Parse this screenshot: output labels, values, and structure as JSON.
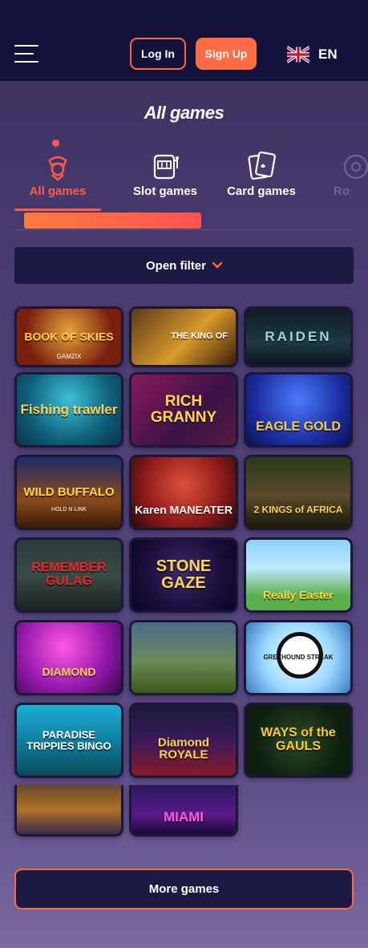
{
  "header": {
    "login_label": "Log In",
    "signup_label": "Sign Up",
    "language": "EN"
  },
  "page_title": "All games",
  "tabs": [
    {
      "label": "All games",
      "icon": "joker-icon",
      "active": true
    },
    {
      "label": "Slot games",
      "icon": "slot-machine-icon",
      "active": false
    },
    {
      "label": "Card games",
      "icon": "cards-icon",
      "active": false
    },
    {
      "label": "Ro",
      "icon": "roulette-icon",
      "active": false
    }
  ],
  "filter": {
    "label": "Open filter",
    "icon": "chevron-down-icon"
  },
  "games": [
    {
      "title": "BOOK OF SKIES",
      "sub": "GAMZIX"
    },
    {
      "title": "THE KING OF",
      "sub": ""
    },
    {
      "title": "RAIDEN",
      "sub": ""
    },
    {
      "title": "Fishing trawler",
      "sub": ""
    },
    {
      "title": "RICH GRANNY",
      "sub": ""
    },
    {
      "title": "EAGLE GOLD",
      "sub": ""
    },
    {
      "title": "WILD BUFFALO",
      "sub": "HOLD N LINK"
    },
    {
      "title": "Karen MANEATER",
      "sub": ""
    },
    {
      "title": "2 KINGS of AFRICA",
      "sub": ""
    },
    {
      "title": "REMEMBER GULAG",
      "sub": ""
    },
    {
      "title": "STONE GAZE",
      "sub": ""
    },
    {
      "title": "Really Easter",
      "sub": ""
    },
    {
      "title": "DIAMOND",
      "sub": ""
    },
    {
      "title": "",
      "sub": ""
    },
    {
      "title": "GREYHOUND STREAK",
      "sub": ""
    },
    {
      "title": "PARADISE TRIPPIES BINGO",
      "sub": ""
    },
    {
      "title": "Diamond ROYALE",
      "sub": ""
    },
    {
      "title": "WAYS of the GAULS",
      "sub": ""
    },
    {
      "title": "",
      "sub": ""
    },
    {
      "title": "MIAMI",
      "sub": ""
    }
  ],
  "more_label": "More games",
  "colors": {
    "accent": "#ff5a4a",
    "header_bg": "#14123a",
    "panel_bg": "#1c1942"
  }
}
